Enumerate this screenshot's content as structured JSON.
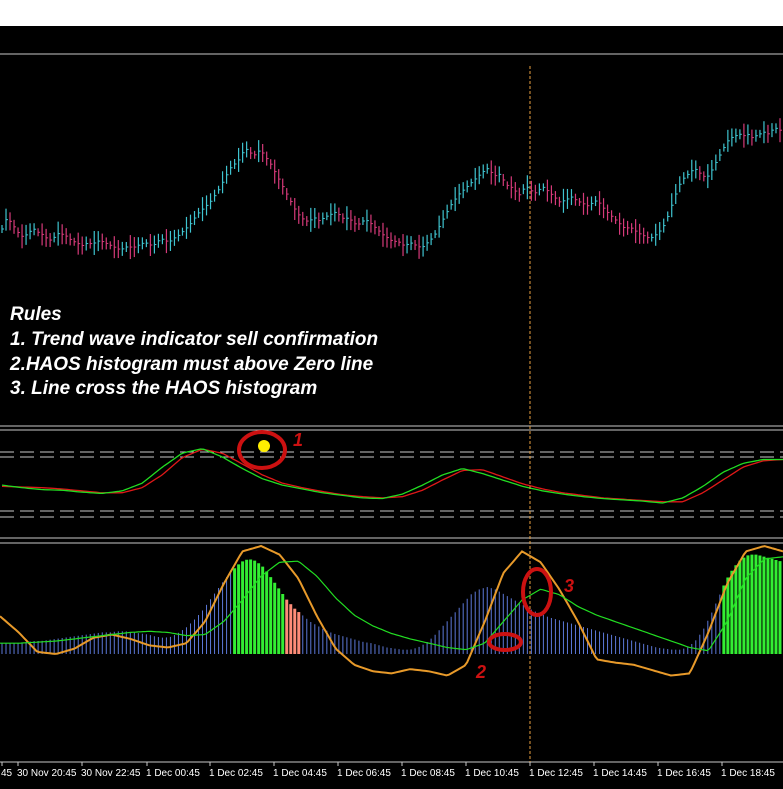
{
  "rules": {
    "title": "Rules",
    "lines": [
      "1. Trend wave indicator sell confirmation",
      "2.HAOS histogram must above Zero line",
      "3. Line cross the HAOS histogram"
    ]
  },
  "markers": [
    "1",
    "2",
    "3"
  ],
  "chart_data": {
    "type": "line",
    "x_ticks": [
      "45",
      "30 Nov 20:45",
      "30 Nov 22:45",
      "1 Dec 00:45",
      "1 Dec 02:45",
      "1 Dec 04:45",
      "1 Dec 06:45",
      "1 Dec 08:45",
      "1 Dec 10:45",
      "1 Dec 12:45",
      "1 Dec 14:45",
      "1 Dec 16:45",
      "1 Dec 18:45"
    ],
    "bar_count": 195,
    "price_level": [
      0.4,
      0.45,
      0.44,
      0.41,
      0.38,
      0.36,
      0.37,
      0.39,
      0.4,
      0.38,
      0.37,
      0.35,
      0.34,
      0.36,
      0.38,
      0.37,
      0.36,
      0.34,
      0.33,
      0.32,
      0.31,
      0.33,
      0.32,
      0.33,
      0.34,
      0.33,
      0.32,
      0.31,
      0.3,
      0.29,
      0.3,
      0.31,
      0.3,
      0.31,
      0.32,
      0.33,
      0.32,
      0.31,
      0.33,
      0.35,
      0.34,
      0.33,
      0.35,
      0.36,
      0.38,
      0.4,
      0.42,
      0.45,
      0.48,
      0.5,
      0.52,
      0.54,
      0.57,
      0.6,
      0.64,
      0.68,
      0.72,
      0.74,
      0.76,
      0.8,
      0.82,
      0.8,
      0.79,
      0.81,
      0.8,
      0.77,
      0.74,
      0.7,
      0.66,
      0.62,
      0.58,
      0.54,
      0.5,
      0.47,
      0.45,
      0.44,
      0.45,
      0.46,
      0.44,
      0.46,
      0.47,
      0.48,
      0.49,
      0.47,
      0.45,
      0.46,
      0.44,
      0.42,
      0.43,
      0.45,
      0.44,
      0.42,
      0.4,
      0.38,
      0.36,
      0.35,
      0.33,
      0.34,
      0.32,
      0.31,
      0.33,
      0.32,
      0.31,
      0.3,
      0.32,
      0.34,
      0.36,
      0.4,
      0.44,
      0.48,
      0.52,
      0.55,
      0.58,
      0.6,
      0.62,
      0.64,
      0.66,
      0.68,
      0.7,
      0.72,
      0.7,
      0.68,
      0.69,
      0.66,
      0.63,
      0.62,
      0.6,
      0.58,
      0.61,
      0.62,
      0.6,
      0.59,
      0.61,
      0.62,
      0.6,
      0.58,
      0.56,
      0.54,
      0.55,
      0.56,
      0.57,
      0.55,
      0.54,
      0.53,
      0.52,
      0.54,
      0.55,
      0.53,
      0.5,
      0.48,
      0.46,
      0.44,
      0.42,
      0.4,
      0.41,
      0.4,
      0.38,
      0.37,
      0.36,
      0.35,
      0.36,
      0.38,
      0.4,
      0.44,
      0.5,
      0.56,
      0.62,
      0.66,
      0.68,
      0.7,
      0.72,
      0.7,
      0.68,
      0.67,
      0.7,
      0.74,
      0.78,
      0.82,
      0.86,
      0.88,
      0.89,
      0.9,
      0.89,
      0.9,
      0.88,
      0.89,
      0.9,
      0.91,
      0.9,
      0.92,
      0.93,
      0.92
    ],
    "trend_wave": {
      "red": [
        0.4,
        0.39,
        0.38,
        0.36,
        0.33,
        0.3,
        0.3,
        0.38,
        0.58,
        0.85,
        0.98,
        0.92,
        0.75,
        0.58,
        0.45,
        0.38,
        0.32,
        0.27,
        0.24,
        0.22,
        0.24,
        0.34,
        0.5,
        0.65,
        0.66,
        0.55,
        0.44,
        0.36,
        0.3,
        0.26,
        0.22,
        0.2,
        0.18,
        0.16,
        0.16,
        0.3,
        0.5,
        0.7,
        0.8,
        0.82
      ],
      "green": [
        0.42,
        0.38,
        0.35,
        0.34,
        0.31,
        0.29,
        0.33,
        0.45,
        0.7,
        0.92,
        0.99,
        0.86,
        0.68,
        0.52,
        0.42,
        0.36,
        0.3,
        0.26,
        0.22,
        0.21,
        0.28,
        0.42,
        0.58,
        0.68,
        0.6,
        0.5,
        0.4,
        0.33,
        0.28,
        0.24,
        0.21,
        0.19,
        0.17,
        0.14,
        0.22,
        0.4,
        0.62,
        0.76,
        0.82,
        0.82
      ]
    },
    "haos": {
      "histogram": [
        0.1,
        0.1,
        0.1,
        0.11,
        0.12,
        0.12,
        0.13,
        0.14,
        0.15,
        0.16,
        0.17,
        0.18,
        0.19,
        0.2,
        0.2,
        0.21,
        0.21,
        0.2,
        0.19,
        0.18,
        0.16,
        0.15,
        0.16,
        0.2,
        0.25,
        0.32,
        0.4,
        0.5,
        0.6,
        0.7,
        0.78,
        0.85,
        0.88,
        0.86,
        0.8,
        0.7,
        0.6,
        0.5,
        0.42,
        0.36,
        0.3,
        0.26,
        0.22,
        0.19,
        0.17,
        0.15,
        0.13,
        0.11,
        0.1,
        0.08,
        0.06,
        0.05,
        0.04,
        0.04,
        0.06,
        0.1,
        0.16,
        0.24,
        0.32,
        0.4,
        0.48,
        0.56,
        0.6,
        0.62,
        0.6,
        0.56,
        0.52,
        0.48,
        0.44,
        0.4,
        0.37,
        0.34,
        0.32,
        0.3,
        0.28,
        0.26,
        0.24,
        0.22,
        0.2,
        0.18,
        0.16,
        0.14,
        0.12,
        0.1,
        0.08,
        0.06,
        0.05,
        0.04,
        0.04,
        0.06,
        0.12,
        0.22,
        0.36,
        0.52,
        0.68,
        0.8,
        0.88,
        0.92,
        0.92,
        0.9,
        0.88,
        0.86
      ],
      "histogram_colors": [
        "blue",
        "blue",
        "blue",
        "blue",
        "blue",
        "blue",
        "blue",
        "blue",
        "blue",
        "blue",
        "blue",
        "blue",
        "blue",
        "blue",
        "blue",
        "blue",
        "blue",
        "blue",
        "blue",
        "blue",
        "blue",
        "blue",
        "blue",
        "blue",
        "blue",
        "blue",
        "blue",
        "blue",
        "blue",
        "blue",
        "green",
        "green",
        "green",
        "green",
        "green",
        "green",
        "green",
        "pink",
        "pink",
        "blue",
        "blue",
        "blue",
        "blue",
        "blue",
        "blue",
        "blue",
        "blue",
        "blue",
        "blue",
        "blue",
        "blue",
        "blue",
        "blue",
        "blue",
        "blue",
        "blue",
        "blue",
        "blue",
        "blue",
        "blue",
        "blue",
        "blue",
        "blue",
        "blue",
        "blue",
        "blue",
        "blue",
        "blue",
        "blue",
        "blue",
        "blue",
        "blue",
        "blue",
        "blue",
        "blue",
        "blue",
        "blue",
        "blue",
        "blue",
        "blue",
        "blue",
        "blue",
        "blue",
        "blue",
        "blue",
        "blue",
        "blue",
        "blue",
        "blue",
        "blue",
        "blue",
        "blue",
        "blue",
        "green",
        "green",
        "green",
        "green",
        "green",
        "green",
        "green",
        "green"
      ],
      "orange": [
        0.35,
        0.2,
        0.02,
        0.0,
        0.05,
        0.15,
        0.18,
        0.14,
        0.08,
        0.06,
        0.1,
        0.3,
        0.65,
        0.95,
        1.0,
        0.92,
        0.7,
        0.35,
        0.05,
        -0.1,
        -0.16,
        -0.18,
        -0.14,
        -0.16,
        -0.2,
        -0.1,
        0.3,
        0.75,
        0.95,
        0.85,
        0.6,
        0.3,
        -0.05,
        -0.08,
        -0.1,
        -0.15,
        -0.2,
        -0.18,
        0.2,
        0.65,
        0.95,
        1.0,
        0.95
      ],
      "green": [
        0.1,
        0.1,
        0.11,
        0.12,
        0.14,
        0.16,
        0.18,
        0.2,
        0.21,
        0.2,
        0.17,
        0.18,
        0.3,
        0.5,
        0.72,
        0.85,
        0.86,
        0.72,
        0.52,
        0.36,
        0.26,
        0.19,
        0.14,
        0.1,
        0.06,
        0.04,
        0.1,
        0.3,
        0.5,
        0.6,
        0.55,
        0.44,
        0.36,
        0.3,
        0.24,
        0.18,
        0.12,
        0.06,
        0.03,
        0.3,
        0.7,
        0.88,
        0.9
      ]
    }
  },
  "colors": {
    "background": "#000000",
    "bull_bar": "#3fc4d0",
    "bear_bar": "#d63a7a",
    "trend_red": "#e01818",
    "trend_green": "#22dd22",
    "haos_blue": "#5c78d8",
    "haos_green": "#33ee33",
    "haos_pink": "#ff8c78",
    "haos_orange": "#e89a2a",
    "marker": "#cc1111",
    "dot": "#ffee00"
  }
}
